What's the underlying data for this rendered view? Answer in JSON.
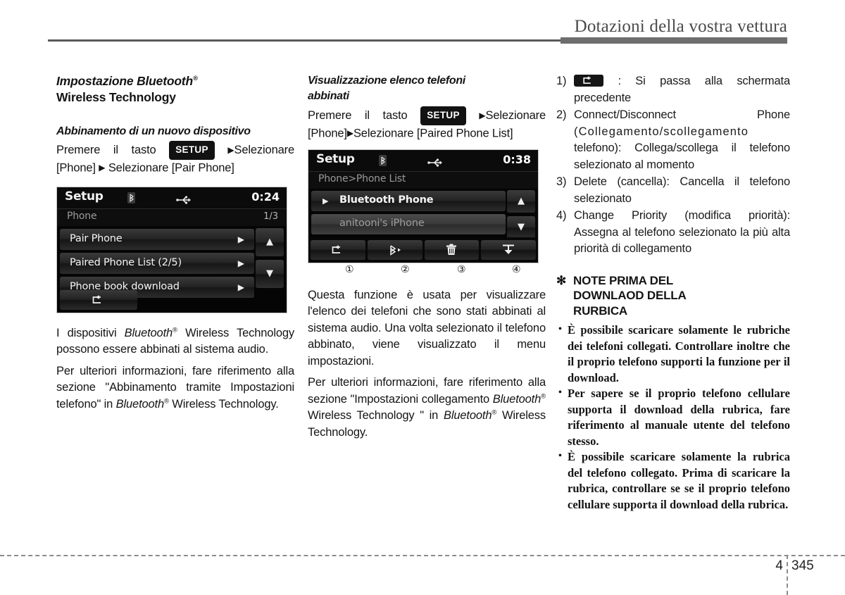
{
  "header": {
    "title": "Dotazioni della vostra vettura"
  },
  "col1": {
    "heading_italic": "Impostazione Bluetooth",
    "heading_sup": "®",
    "heading_line2": "Wireless Technology",
    "subheading": "Abbinamento di un nuovo dispositivo",
    "instr_pre": "Premere il tasto",
    "setup_label": "SETUP",
    "instr_mid": "Selezionare",
    "instr_post1": "[Phone]",
    "instr_post2": "Selezionare [Pair Phone]",
    "para1_a": "I dispositivi ",
    "para1_bt": "Bluetooth",
    "para1_sup": "®",
    "para1_b": " Wireless Technology possono essere abbinati al sistema audio.",
    "para2_a": "Per ulteriori informazioni, fare riferimento alla sezione \"Abbinamento tramite Impostazioni telefono\" in ",
    "para2_bt": "Bluetooth",
    "para2_sup": "®",
    "para2_b": " Wireless Technology."
  },
  "screen1": {
    "title": "Setup",
    "clock": "0:24",
    "breadcrumb": "Phone",
    "page_indicator": "1/3",
    "rows": [
      {
        "label": "Pair Phone",
        "arrow": "▶"
      },
      {
        "label": "Paired Phone List  (2/5)",
        "arrow": "▶"
      },
      {
        "label": "Phone book download",
        "arrow": "▶"
      }
    ],
    "scroll_up": "▲",
    "scroll_down": "▼",
    "back_icon": "back-arrow-icon"
  },
  "col2": {
    "subheading_l1": "Visualizzazione elenco telefoni",
    "subheading_l2": "abbinati",
    "instr_pre": "Premere il tasto",
    "setup_label": "SETUP",
    "instr_mid": "Selezionare",
    "instr_post1": "[Phone]",
    "instr_post2": "Selezionare [Paired Phone List]",
    "para1": "Questa funzione è usata per visualizzare l'elenco dei telefoni che sono stati abbinati al sistema audio. Una volta selezionato il telefono abbinato, viene visualizzato il menu impostazioni.",
    "para2_a": "Per ulteriori informazioni, fare riferimento alla sezione \"Impostazioni collegamento ",
    "para2_bt1": "Bluetooth",
    "para2_sup1": "®",
    "para2_b": " Wireless Technology \" in ",
    "para2_bt2": "Bluetooth",
    "para2_sup2": "®",
    "para2_c": " Wireless Technology."
  },
  "screen2": {
    "title": "Setup",
    "clock": "0:38",
    "breadcrumb": "Phone>Phone List",
    "rows": [
      {
        "label": "Bluetooth Phone",
        "selected_marker": "▶"
      },
      {
        "label": "anitooni's iPhone"
      }
    ],
    "scroll_up": "▲",
    "scroll_down": "▼",
    "toolbar": [
      {
        "icon": "back-arrow-icon",
        "callout": "①"
      },
      {
        "icon": "bluetooth-connect-icon",
        "callout": "②"
      },
      {
        "icon": "trash-can-icon",
        "callout": "③"
      },
      {
        "icon": "change-priority-icon",
        "callout": "④"
      }
    ]
  },
  "col3": {
    "items": [
      {
        "num": "1)",
        "has_icon": true,
        "icon": "back-arrow-icon",
        "text": ": Si passa alla schermata precedente"
      },
      {
        "num": "2)",
        "has_icon": false,
        "text_a": "Connect/Disconnect",
        "text_spaced": "Phone",
        "text_wide": "(Collegamento/scollegamento",
        "text_b": "telefono): Collega/scollega il telefono selezionato al momento"
      },
      {
        "num": "3)",
        "has_icon": false,
        "text": "Delete (cancella): Cancella il telefono selezionato"
      },
      {
        "num": "4)",
        "has_icon": false,
        "text": "Change Priority (modifica priorità): Assegna al telefono selezionato la più alta priorità di collegamento"
      }
    ],
    "note": {
      "star": "✻",
      "title_l1": "NOTE PRIMA DEL",
      "title_l2": "DOWNLAOD DELLA",
      "title_l3": "RURBICA",
      "bullet_char": "•",
      "bullets": [
        "È possibile scaricare solamente le rubriche dei telefoni collegati. Controllare inoltre che il proprio telefono supporti la funzione per il download.",
        "Per sapere se il proprio telefono cellulare supporta il download della rubrica, fare riferimento al manuale utente del telefono stesso.",
        "È possibile scaricare solamente la rubrica del telefono collegato. Prima di scaricare la rubrica, controllare se se il proprio telefono cellulare supporta il download della rubrica."
      ]
    }
  },
  "footer": {
    "chapter": "4",
    "page": "345"
  }
}
